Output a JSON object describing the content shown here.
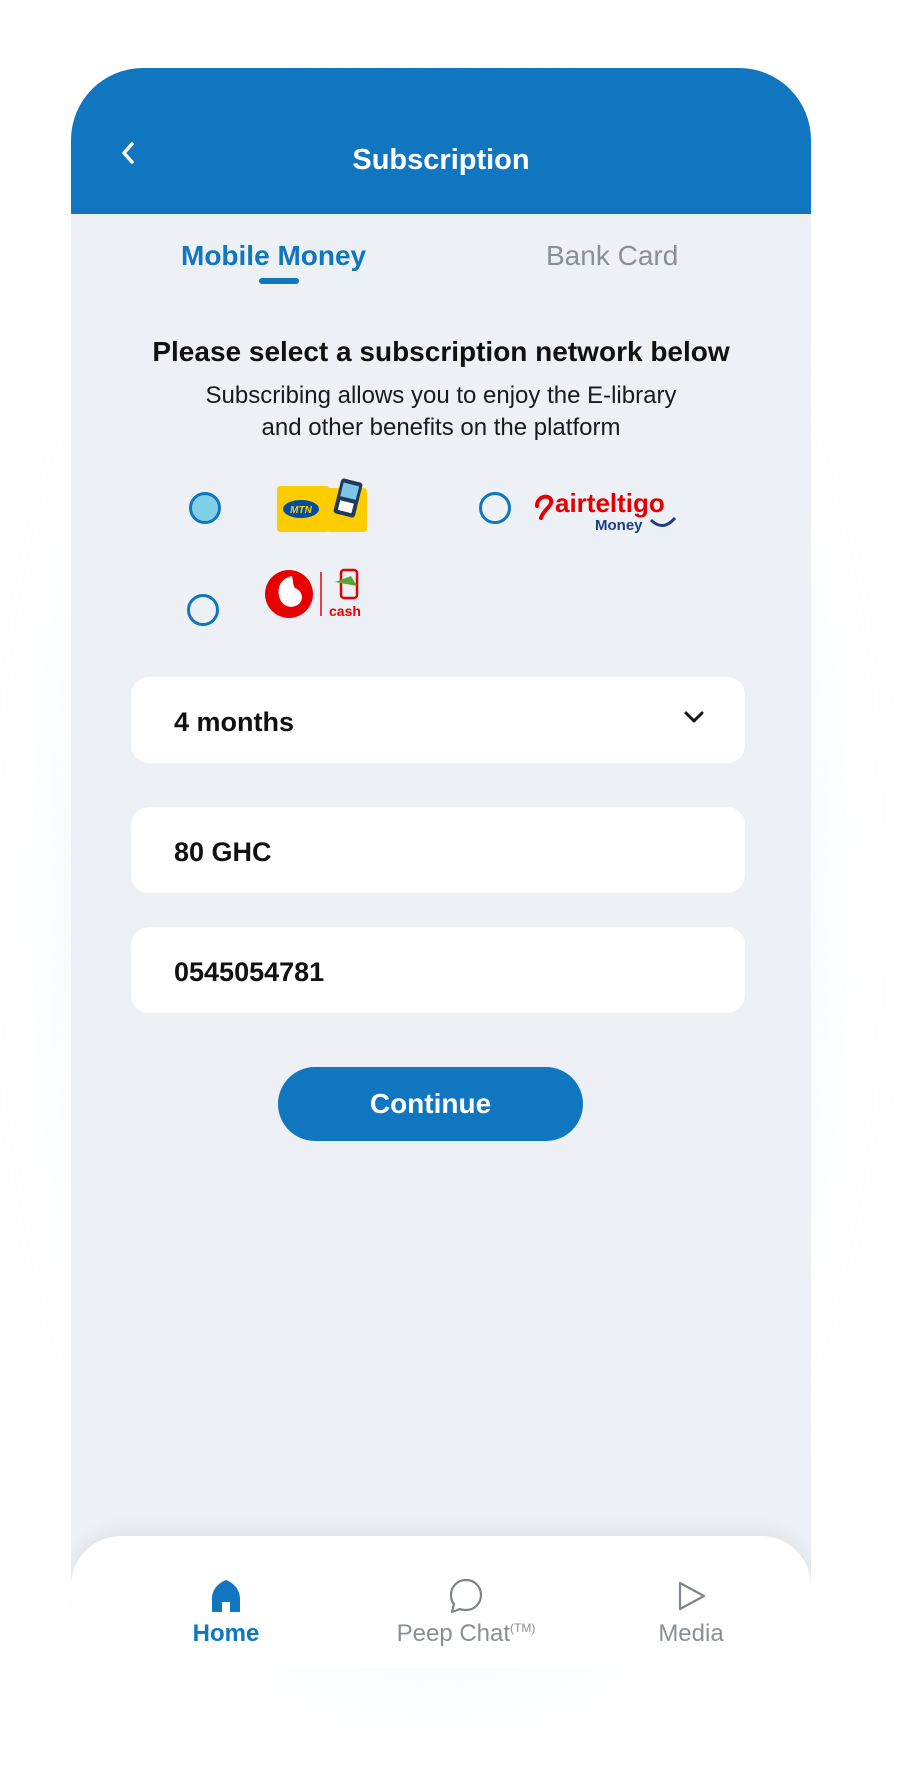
{
  "header": {
    "title": "Subscription"
  },
  "tabs": {
    "active": "Mobile Money",
    "inactive": "Bank Card"
  },
  "intro": {
    "heading": "Please select a subscription network below",
    "sub_line1": "Subscribing allows you to enjoy the E-library",
    "sub_line2": "and other benefits on the platform"
  },
  "networks": {
    "mtn": {
      "logo_text": "MTN",
      "selected": true
    },
    "airteltigo": {
      "logo_text": "airteltigo",
      "logo_sub": "Money",
      "selected": false
    },
    "vodafone": {
      "logo_text": "cash",
      "selected": false
    }
  },
  "form": {
    "duration": "4 months",
    "amount": "80 GHC",
    "phone": "0545054781",
    "continue_label": "Continue"
  },
  "nav": {
    "home": "Home",
    "chat": "Peep Chat",
    "chat_tm": "(TM)",
    "media": "Media"
  },
  "colors": {
    "primary": "#0f76bf",
    "background": "#edf1f5",
    "radio_fill": "#7fd0e6"
  }
}
